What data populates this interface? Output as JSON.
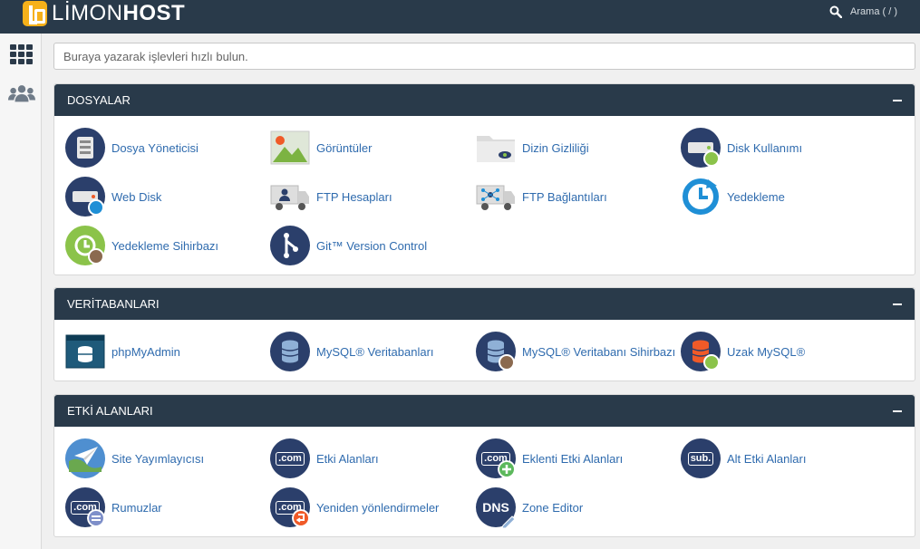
{
  "brand": {
    "light": "LİMON",
    "bold": "HOST"
  },
  "top_search": {
    "label": "Arama ( / )"
  },
  "quick_search": {
    "placeholder": "Buraya yazarak işlevleri hızlı bulun."
  },
  "colors": {
    "header_bg": "#293a4a",
    "accent_yellow": "#f6b11a",
    "link_blue": "#2f6bae",
    "icon_navy": "#2b3f6b",
    "icon_green": "#8bc34a",
    "icon_blue": "#1f8fd6",
    "icon_orange": "#f05a28"
  },
  "sections": {
    "files": {
      "title": "DOSYALAR",
      "items": [
        {
          "label": "Dosya Yöneticisi",
          "icon": "file-manager-icon"
        },
        {
          "label": "Görüntüler",
          "icon": "images-icon"
        },
        {
          "label": "Dizin Gizliliği",
          "icon": "directory-privacy-icon"
        },
        {
          "label": "Disk Kullanımı",
          "icon": "disk-usage-icon"
        },
        {
          "label": "Web Disk",
          "icon": "web-disk-icon"
        },
        {
          "label": "FTP Hesapları",
          "icon": "ftp-accounts-icon"
        },
        {
          "label": "FTP Bağlantıları",
          "icon": "ftp-connections-icon"
        },
        {
          "label": "Yedekleme",
          "icon": "backup-icon"
        },
        {
          "label": "Yedekleme Sihirbazı",
          "icon": "backup-wizard-icon"
        },
        {
          "label": "Git™ Version Control",
          "icon": "git-icon"
        }
      ]
    },
    "databases": {
      "title": "VERİTABANLARI",
      "items": [
        {
          "label": "phpMyAdmin",
          "icon": "phpmyadmin-icon"
        },
        {
          "label": "MySQL® Veritabanları",
          "icon": "mysql-databases-icon"
        },
        {
          "label": "MySQL® Veritabanı Sihirbazı",
          "icon": "mysql-wizard-icon"
        },
        {
          "label": "Uzak MySQL®",
          "icon": "remote-mysql-icon"
        }
      ]
    },
    "domains": {
      "title": "ETKİ ALANLARI",
      "items": [
        {
          "label": "Site Yayımlayıcısı",
          "icon": "site-publisher-icon"
        },
        {
          "label": "Etki Alanları",
          "icon": "domains-icon"
        },
        {
          "label": "Eklenti Etki Alanları",
          "icon": "addon-domains-icon"
        },
        {
          "label": "Alt Etki Alanları",
          "icon": "subdomains-icon"
        },
        {
          "label": "Rumuzlar",
          "icon": "aliases-icon"
        },
        {
          "label": "Yeniden yönlendirmeler",
          "icon": "redirects-icon"
        },
        {
          "label": "Zone Editor",
          "icon": "zone-editor-icon"
        }
      ]
    }
  },
  "icon_text": {
    "com": ".com",
    "sub": "sub.",
    "dns": "DNS"
  }
}
